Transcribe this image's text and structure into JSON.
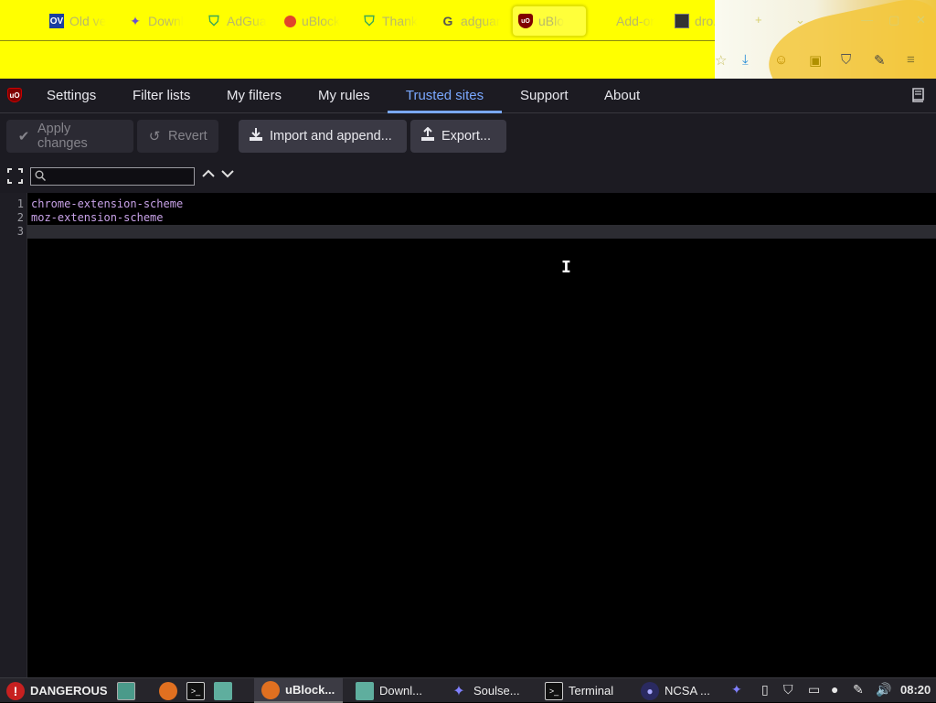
{
  "browser": {
    "tabs": [
      {
        "icon": "ov-icon",
        "label": "Old ve"
      },
      {
        "icon": "hummingbird-icon",
        "label": "Downl"
      },
      {
        "icon": "adguard-shield-icon",
        "label": "AdGua"
      },
      {
        "icon": "firefox-icon",
        "label": "uBlock"
      },
      {
        "icon": "adguard-shield-icon",
        "label": "Thank"
      },
      {
        "icon": "google-icon",
        "label": "adguar"
      },
      {
        "icon": "ublock-icon",
        "label": "uBlo"
      },
      {
        "icon": "blank-icon",
        "label": "Add-or"
      },
      {
        "icon": "image-file-icon",
        "label": "dro.pn"
      }
    ],
    "new_tab_symbol": "+",
    "tab_list_symbol": "⌄"
  },
  "dashboard": {
    "logo_text": "uO",
    "tabs": [
      "Settings",
      "Filter lists",
      "My filters",
      "My rules",
      "Trusted sites",
      "Support",
      "About"
    ],
    "active_tab": "Trusted sites"
  },
  "toolbar": {
    "apply_label": "Apply changes",
    "revert_label": "Revert",
    "import_label": "Import and append...",
    "export_label": "Export..."
  },
  "search": {
    "value": "",
    "placeholder": ""
  },
  "editor": {
    "line_numbers": [
      "1",
      "2",
      "3"
    ],
    "lines": [
      "chrome-extension-scheme",
      "moz-extension-scheme",
      ""
    ]
  },
  "taskbar": {
    "danger_label": "DANGEROUS",
    "windows": [
      {
        "icon": "firefox-icon",
        "label": "uBlock..."
      },
      {
        "icon": "folder-icon",
        "label": "Downl..."
      },
      {
        "icon": "hummingbird-icon",
        "label": "Soulse..."
      },
      {
        "icon": "terminal-icon",
        "label": "Terminal"
      },
      {
        "icon": "ncsa-icon",
        "label": "NCSA ..."
      }
    ],
    "clock": "08:20"
  },
  "colors": {
    "toolbar_yellow": "#ffff00",
    "dashboard_bg": "#1c1b22",
    "active_tab": "#7aa8ff",
    "code_text": "#c8a2e8"
  }
}
